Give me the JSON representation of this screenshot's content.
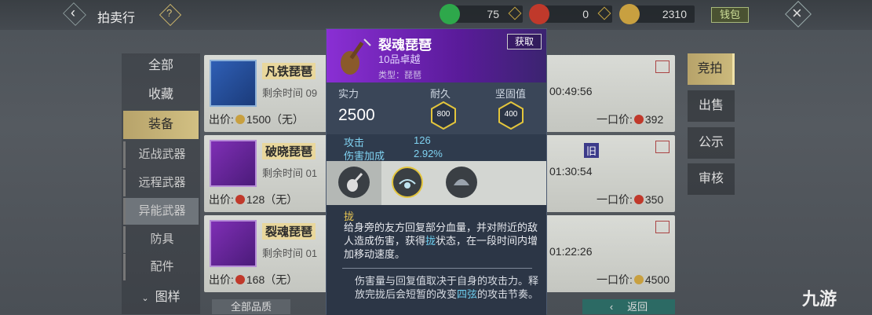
{
  "header": {
    "title": "拍卖行",
    "currencies": [
      {
        "icon": "jade-icon",
        "value": "75",
        "color": "#2ea84b"
      },
      {
        "icon": "red-coin-icon",
        "value": "0",
        "color": "#c0392b"
      },
      {
        "icon": "gold-leaf-icon",
        "value": "2310",
        "color": "#c8a040"
      }
    ],
    "wallet_label": "钱包"
  },
  "categories": [
    {
      "label": "全部"
    },
    {
      "label": "收藏"
    },
    {
      "label": "装备"
    }
  ],
  "subcategories": [
    {
      "label": "近战武器"
    },
    {
      "label": "远程武器"
    },
    {
      "label": "异能武器"
    },
    {
      "label": "防具"
    },
    {
      "label": "配件"
    }
  ],
  "collapsed_category": "图样",
  "items": [
    {
      "name": "凡铁琵琶",
      "time_label": "剩余时间",
      "time_l": "09",
      "price_label": "出价:",
      "price": "1500（无）",
      "time_r": "00:49:56",
      "bid_label": "一口价:",
      "bid": "392"
    },
    {
      "name": "破晓琵琶",
      "time_label": "剩余时间",
      "time_l": "01",
      "price_label": "出价:",
      "price": "128（无）",
      "time_r": "01:30:54",
      "bid_label": "一口价:",
      "bid": "350",
      "badge": "旧"
    },
    {
      "name": "裂魂琵琶",
      "time_label": "剩余时间",
      "time_l": "01",
      "price_label": "出价:",
      "price": "168（无）",
      "time_r": "01:22:26",
      "bid_label": "一口价:",
      "bid": "4500"
    }
  ],
  "right_tabs": [
    {
      "label": "竞拍"
    },
    {
      "label": "出售"
    },
    {
      "label": "公示"
    },
    {
      "label": "审核"
    }
  ],
  "popup": {
    "name": "裂魂琵琶",
    "grade": "10品卓越",
    "type": "类型：琵琶",
    "acquire_label": "获取",
    "power_label": "实力",
    "power": "2500",
    "durability_label": "耐久",
    "durability": "800",
    "firmness_label": "坚固值",
    "firmness": "400",
    "attrs": [
      {
        "name": "攻击",
        "value": "126"
      },
      {
        "name": "伤害加成",
        "value": "2.92%"
      }
    ],
    "skill_name": "拢",
    "desc_a": "给身旁的友方回复部分血量，并对附近的敌人造成伤害，获得",
    "desc_b": "拢",
    "desc_c": "状态，在一段时间内增加移动速度。",
    "desc2_a": "伤害量与回复值取决于自身的攻击力。释放完拢后会短暂的改变",
    "desc2_b": "四弦",
    "desc2_c": "的攻击节奏。"
  },
  "bottom": {
    "filter_label": "全部品质",
    "back_label": "返回"
  },
  "watermark": "九游"
}
